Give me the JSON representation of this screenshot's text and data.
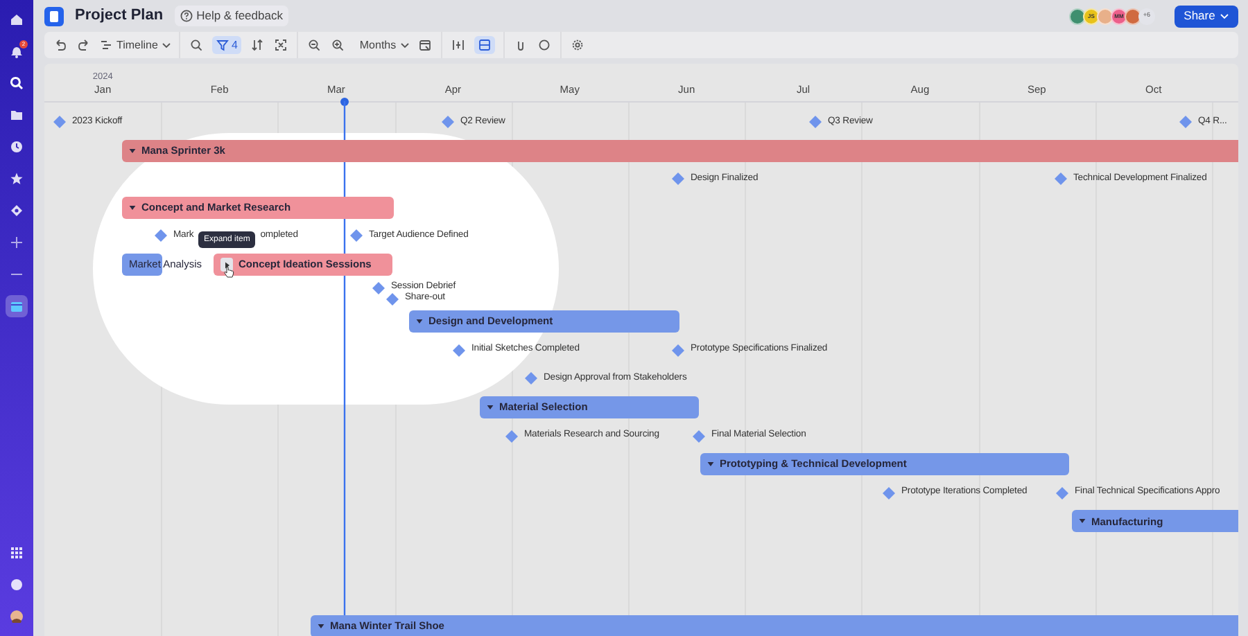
{
  "sidebar": {
    "notification_badge": "2",
    "items": [
      {
        "selected": false
      },
      {
        "selected": false
      },
      {
        "selected": false
      },
      {
        "selected": false
      },
      {
        "selected": false
      },
      {
        "selected": false
      },
      {
        "selected": false
      },
      {
        "selected": false
      },
      {
        "selected": false
      },
      {
        "selected": true
      }
    ]
  },
  "header": {
    "title": "Project Plan",
    "help_link": "Help & feedback",
    "avatars": [
      {
        "color": "#3f8f6f"
      },
      {
        "initials": "JS",
        "color": "#e8c21a"
      },
      {
        "color": "#e8b08a"
      },
      {
        "initials": "MM",
        "color": "#ec5f8a"
      },
      {
        "color": "#d06a40"
      }
    ],
    "more_count": "+6",
    "share_button": "Share"
  },
  "toolbar": {
    "view": "Timeline",
    "filter_count": "4",
    "filter_active": true,
    "scale": "Months",
    "layout_active": true
  },
  "timeline": {
    "year": "2024",
    "months": [
      "Jan",
      "Feb",
      "Mar",
      "Apr",
      "May",
      "Jun",
      "Jul",
      "Aug",
      "Sep",
      "Oct"
    ],
    "lanes": [
      [
        {
          "kind": "milestone",
          "label": "2023 Kickoff"
        },
        {
          "kind": "milestone",
          "label": "Q2 Review"
        },
        {
          "kind": "milestone",
          "label": "Q3 Review"
        },
        {
          "kind": "milestone",
          "label": "Q4 R..."
        }
      ],
      [
        {
          "kind": "group",
          "label": "Mana Sprinter 3k",
          "expanded": true,
          "color": "#dd8387"
        }
      ],
      [
        {
          "kind": "milestone",
          "label": "Design Finalized"
        },
        {
          "kind": "milestone",
          "label": "Technical Development Finalized"
        }
      ],
      [
        {
          "kind": "group",
          "label": "Concept and Market Research",
          "expanded": true,
          "color": "#f0919a"
        }
      ],
      [
        {
          "kind": "milestone",
          "label_parts": [
            "Mark",
            "ompleted"
          ]
        },
        {
          "kind": "milestone",
          "label": "Target Audience Defined"
        }
      ],
      [
        {
          "kind": "task",
          "label": "Market Analysis",
          "color": "#7597e8"
        },
        {
          "kind": "group",
          "label": "Concept Ideation Sessions",
          "expanded": false,
          "tooltip": "Expand item",
          "color": "#f0919a"
        }
      ],
      [
        {
          "kind": "milestone",
          "label": "Session Debrief"
        },
        {
          "kind": "milestone",
          "label": "Share-out"
        }
      ],
      [
        {
          "kind": "group",
          "label": "Design and Development",
          "expanded": true,
          "color": "#7597e8"
        }
      ],
      [
        {
          "kind": "milestone",
          "label": "Initial Sketches Completed"
        },
        {
          "kind": "milestone",
          "label": "Prototype Specifications Finalized"
        }
      ],
      [
        {
          "kind": "milestone",
          "label": "Design Approval from Stakeholders"
        }
      ],
      [
        {
          "kind": "group",
          "label": "Material Selection",
          "expanded": true,
          "color": "#7597e8"
        }
      ],
      [
        {
          "kind": "milestone",
          "label": "Materials Research and Sourcing"
        },
        {
          "kind": "milestone",
          "label": "Final Material Selection"
        }
      ],
      [
        {
          "kind": "group",
          "label": "Prototyping & Technical Development",
          "expanded": true,
          "color": "#7597e8"
        }
      ],
      [
        {
          "kind": "milestone",
          "label": "Prototype Iterations Completed"
        },
        {
          "kind": "milestone",
          "label": "Final Technical Specifications Appro"
        }
      ],
      [
        {
          "kind": "group",
          "label": "Manufacturing",
          "expanded": true,
          "color": "#7597e8"
        }
      ],
      [
        {
          "kind": "group",
          "label": "Mana Winter Trail Shoe",
          "expanded": true,
          "color": "#7597e8"
        }
      ]
    ]
  }
}
